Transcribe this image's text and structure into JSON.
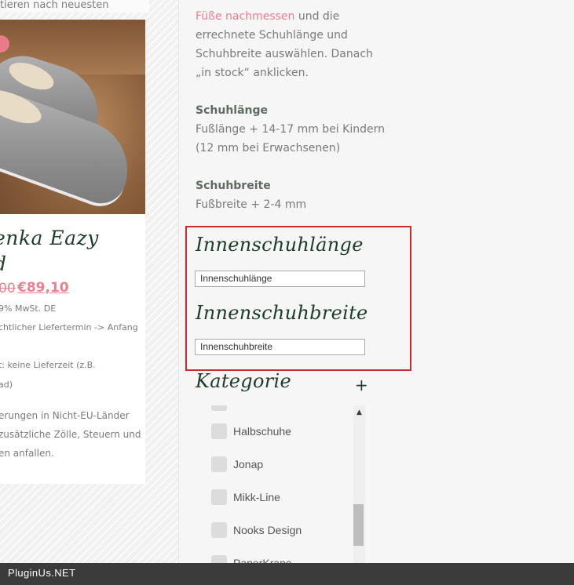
{
  "sort": {
    "label": "tieren nach neuesten"
  },
  "product": {
    "title_line1": "enka Eazy",
    "title_line2": "d",
    "price_old": "00",
    "price_new": "€89,10",
    "vat": "9% MwSt. DE",
    "delivery1": "chtlicher Liefertermin -> Anfang",
    "delivery2": "t: keine Lieferzeit (z.B.",
    "delivery3": "ad)",
    "shipping1": "erungen in Nicht-EU-Länder",
    "shipping2": "zusätzliche Zölle, Steuern und",
    "shipping3": "en anfallen."
  },
  "info": {
    "line1_link": "Füße nachmessen",
    "line1_rest": " und die",
    "line2": "errechnete Schuhlänge und",
    "line3": "Schuhbreite auswählen. Danach",
    "line4": "„in stock“ anklicken.",
    "length_heading": "Schuhlänge",
    "length_line1": "Fußlänge + 14-17 mm bei Kindern",
    "length_line2": "(12 mm bei Erwachsenen)",
    "width_heading": "Schuhbreite",
    "width_line1": "Fußbreite + 2-4 mm"
  },
  "filters": {
    "inner_length": {
      "heading": "Innenschuhlänge",
      "value": "Innenschuhlänge"
    },
    "inner_width": {
      "heading": "Innenschuhbreite",
      "value": "Innenschuhbreite"
    }
  },
  "category": {
    "heading": "Kategorie",
    "plus": "+",
    "items": [
      {
        "label": "Halbschuhe"
      },
      {
        "label": "Jonap"
      },
      {
        "label": "Mikk-Line"
      },
      {
        "label": "Nooks Design"
      },
      {
        "label": "PaperKrane"
      }
    ]
  },
  "footer": {
    "label": "PluginUs.NET"
  },
  "colors": {
    "accent": "#ea7f8b",
    "heading_green": "#1d3d2a",
    "highlight_border": "#c92c2c"
  }
}
